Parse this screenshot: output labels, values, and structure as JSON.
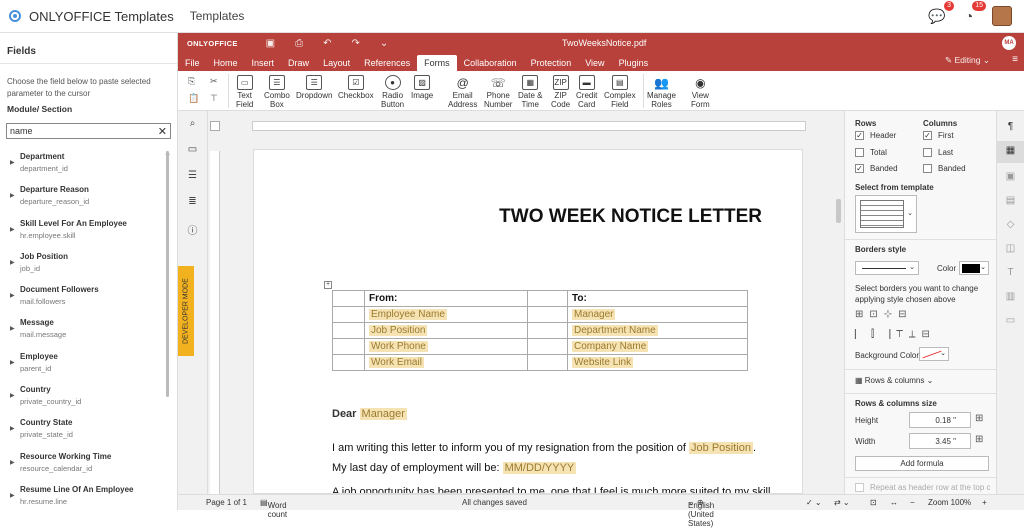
{
  "app": {
    "title": "ONLYOFFICE Templates",
    "breadcrumb": "Templates",
    "chat_badge": "3",
    "notif_badge": "15"
  },
  "fields_panel": {
    "title": "Fields",
    "description": "Choose the field below to paste selected parameter to the cursor",
    "module_label": "Module/ Section",
    "search_value": "name",
    "items": [
      {
        "name": "Department",
        "id": "department_id"
      },
      {
        "name": "Departure Reason",
        "id": "departure_reason_id"
      },
      {
        "name": "Skill Level For An Employee",
        "id": "hr.employee.skill"
      },
      {
        "name": "Job Position",
        "id": "job_id"
      },
      {
        "name": "Document Followers",
        "id": "mail.followers"
      },
      {
        "name": "Message",
        "id": "mail.message"
      },
      {
        "name": "Employee",
        "id": "parent_id"
      },
      {
        "name": "Country",
        "id": "private_country_id"
      },
      {
        "name": "Country State",
        "id": "private_state_id"
      },
      {
        "name": "Resource Working Time",
        "id": "resource_calendar_id"
      },
      {
        "name": "Resume Line Of An Employee",
        "id": "hr.resume.line"
      }
    ]
  },
  "editor": {
    "logo": "ONLYOFFICE",
    "filename": "TwoWeeksNotice.pdf",
    "user_initials": "MA",
    "menu": [
      "File",
      "Home",
      "Insert",
      "Draw",
      "Layout",
      "References",
      "Forms",
      "Collaboration",
      "Protection",
      "View",
      "Plugins"
    ],
    "active_menu": "Forms",
    "editing_label": "Editing",
    "toolbar": [
      {
        "l1": "Text",
        "l2": "Field",
        "icon": "text-field-icon"
      },
      {
        "l1": "Combo",
        "l2": "Box",
        "icon": "combo-box-icon"
      },
      {
        "l1": "Dropdown",
        "l2": "",
        "icon": "dropdown-icon"
      },
      {
        "l1": "Checkbox",
        "l2": "",
        "icon": "checkbox-icon"
      },
      {
        "l1": "Radio",
        "l2": "Button",
        "icon": "radio-button-icon"
      },
      {
        "l1": "Image",
        "l2": "",
        "icon": "image-icon"
      },
      {
        "l1": "Email",
        "l2": "Address",
        "icon": "email-icon"
      },
      {
        "l1": "Phone",
        "l2": "Number",
        "icon": "phone-icon"
      },
      {
        "l1": "Date &",
        "l2": "Time",
        "icon": "date-time-icon"
      },
      {
        "l1": "ZIP",
        "l2": "Code",
        "icon": "zip-code-icon"
      },
      {
        "l1": "Credit",
        "l2": "Card",
        "icon": "credit-card-icon"
      },
      {
        "l1": "Complex",
        "l2": "Field",
        "icon": "complex-field-icon"
      },
      {
        "l1": "Manage",
        "l2": "Roles",
        "icon": "manage-roles-icon"
      },
      {
        "l1": "View",
        "l2": "Form",
        "icon": "view-form-icon"
      }
    ],
    "developer_mode": "DEVELOPER MODE"
  },
  "document": {
    "title": "TWO WEEK NOTICE LETTER",
    "table": {
      "from_label": "From:",
      "to_label": "To:",
      "from_fields": [
        "Employee Name",
        "Job Position",
        "Work Phone",
        "Work Email"
      ],
      "to_fields": [
        "Manager",
        "Department Name",
        "Company Name",
        "Website Link"
      ]
    },
    "dear": "Dear",
    "dear_field": "Manager",
    "para1_a": "I am writing this letter to inform you of my resignation from the position of",
    "para1_field": "Job Position",
    "para1_b": ". My last day of employment will be:",
    "para1_date": "MM/DD/YYYY",
    "para2": "A job opportunity has been presented to me, one that I feel is much more suited to my skill"
  },
  "table_settings": {
    "rows_label": "Rows",
    "columns_label": "Columns",
    "header": "Header",
    "header_checked": true,
    "total": "Total",
    "total_checked": false,
    "banded_rows": "Banded",
    "banded_rows_checked": true,
    "first": "First",
    "first_checked": true,
    "last": "Last",
    "last_checked": false,
    "banded_cols": "Banded",
    "banded_cols_checked": false,
    "template_label": "Select from template",
    "borders_label": "Borders style",
    "color_label": "Color",
    "borders_hint": "Select borders you want to change applying style chosen above",
    "bg_color_label": "Background Color",
    "rows_columns": "Rows & columns",
    "size_label": "Rows & columns size",
    "height_label": "Height",
    "height_value": "0.18 \"",
    "width_label": "Width",
    "width_value": "3.45 \"",
    "add_formula": "Add formula",
    "repeat_header": "Repeat as header row at the top of"
  },
  "statusbar": {
    "page": "Page 1 of 1",
    "word_count": "Word count",
    "saved": "All changes saved",
    "language": "English (United States)",
    "zoom": "Zoom 100%"
  },
  "colors": {
    "header_bg": "#b8413b",
    "field_bg": "#f6e3b4",
    "devmode_bg": "#f2b21f"
  }
}
